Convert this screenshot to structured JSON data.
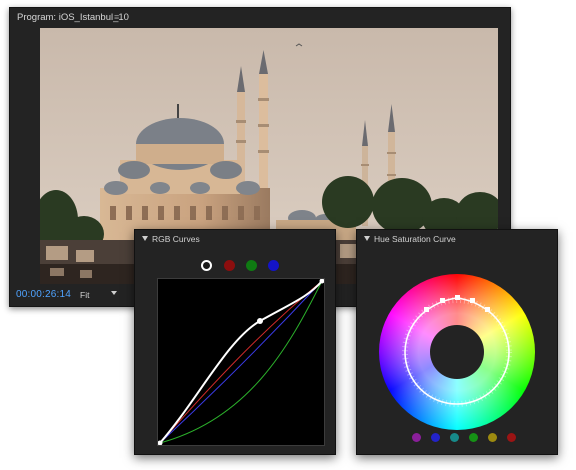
{
  "program_monitor": {
    "title": "Program: iOS_Istanbul_10",
    "menu_icon": "≡",
    "timecode": "00:00:26:14",
    "zoom_select": "Fit"
  },
  "rgb_curves": {
    "title": "RGB Curves",
    "channels": [
      {
        "name": "master",
        "color": "#ffffff",
        "selected": true
      },
      {
        "name": "red",
        "color": "#8c0e0e",
        "selected": false
      },
      {
        "name": "green",
        "color": "#0f7a12",
        "selected": false
      },
      {
        "name": "blue",
        "color": "#1414c8",
        "selected": false
      }
    ]
  },
  "hue_saturation": {
    "title": "Hue Saturation Curve",
    "swatches": [
      "#8a1f9a",
      "#2323c8",
      "#178a8a",
      "#169216",
      "#9c8a10",
      "#9a1414"
    ]
  }
}
